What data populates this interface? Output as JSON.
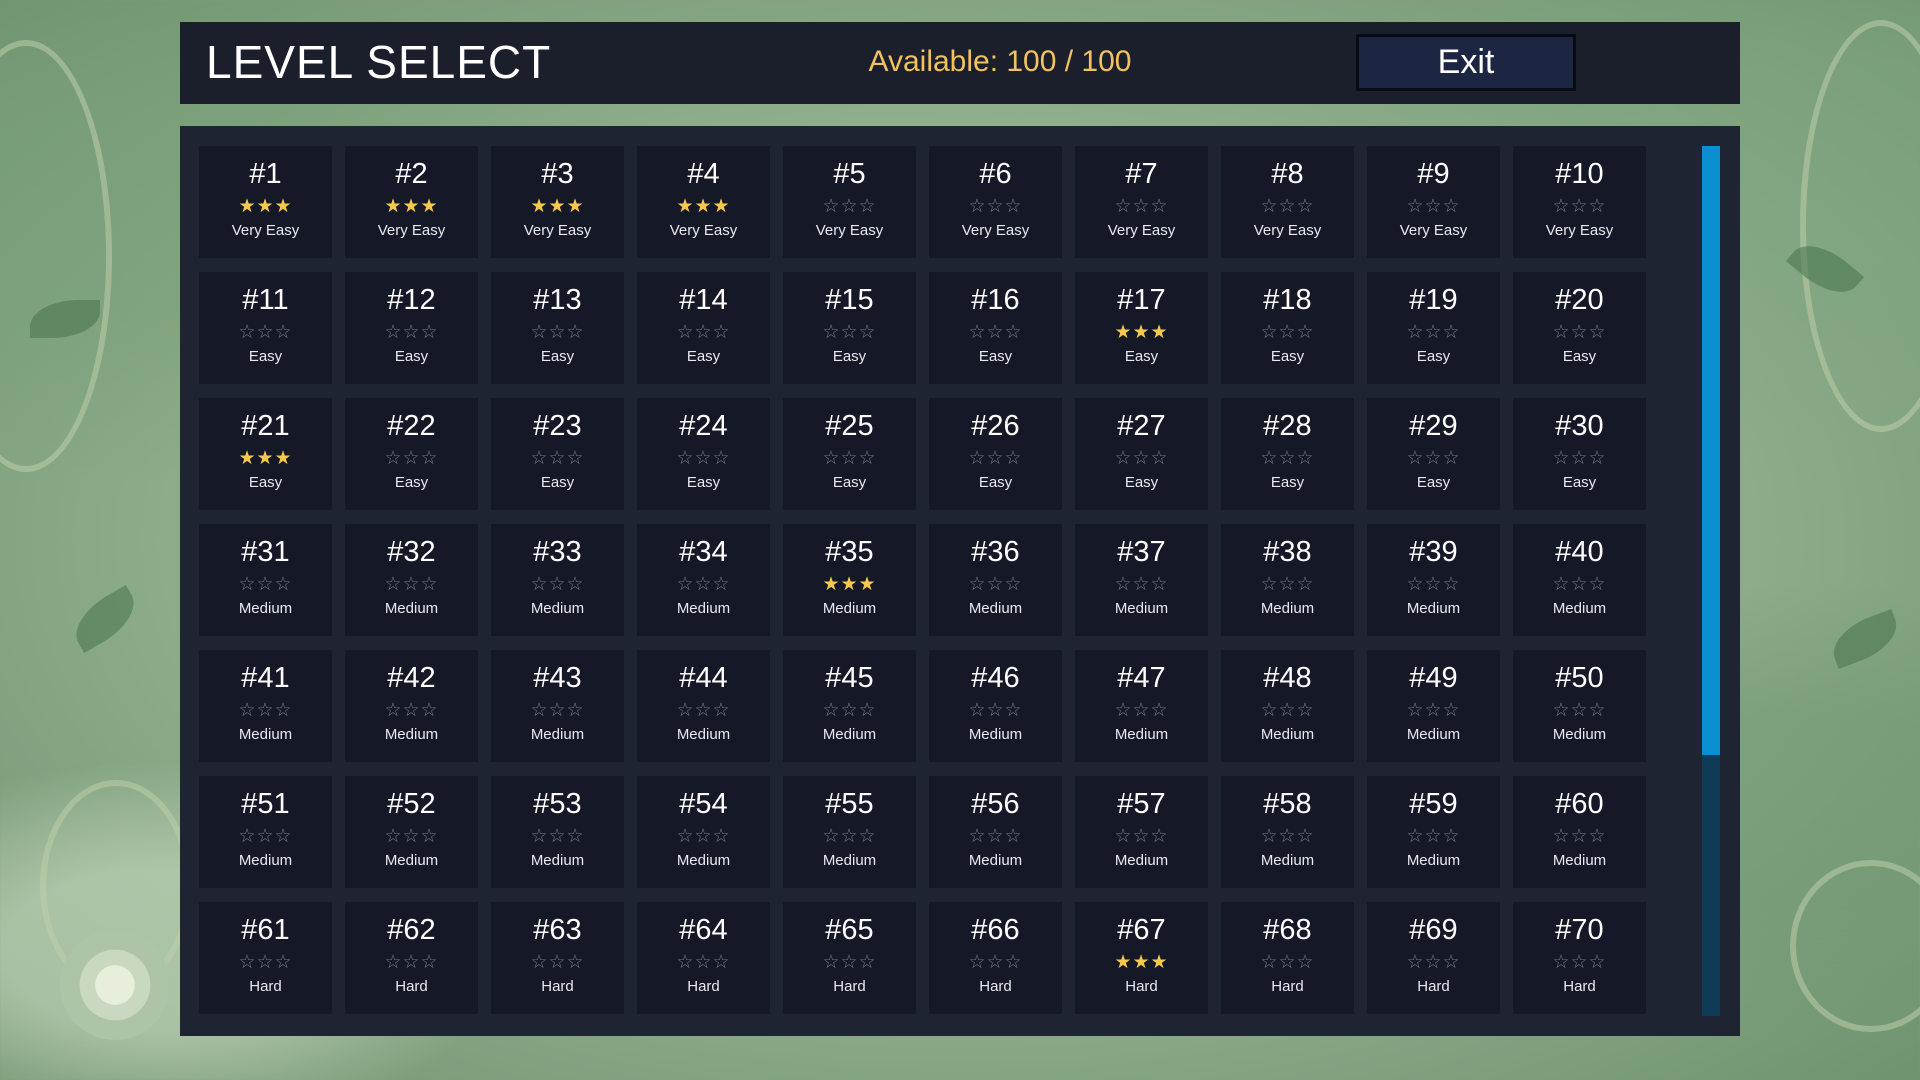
{
  "header": {
    "title": "LEVEL SELECT",
    "available": "Available: 100 / 100",
    "exit_label": "Exit"
  },
  "colors": {
    "available_text": "#f2c260",
    "star_earned": "#f5c94c",
    "star_empty": "#747a8c",
    "scrollbar_thumb": "#0a8fd0",
    "scrollbar_track": "#0e3b55"
  },
  "scroll": {
    "thumb_fraction": 0.7,
    "position_fraction": 0.0
  },
  "levels": [
    {
      "label": "#1",
      "stars": "★★★",
      "earned": true,
      "difficulty": "Very Easy"
    },
    {
      "label": "#2",
      "stars": "★★★",
      "earned": true,
      "difficulty": "Very Easy"
    },
    {
      "label": "#3",
      "stars": "★★★",
      "earned": true,
      "difficulty": "Very Easy"
    },
    {
      "label": "#4",
      "stars": "★★★",
      "earned": true,
      "difficulty": "Very Easy"
    },
    {
      "label": "#5",
      "stars": "☆☆☆",
      "earned": false,
      "difficulty": "Very Easy"
    },
    {
      "label": "#6",
      "stars": "☆☆☆",
      "earned": false,
      "difficulty": "Very Easy"
    },
    {
      "label": "#7",
      "stars": "☆☆☆",
      "earned": false,
      "difficulty": "Very Easy"
    },
    {
      "label": "#8",
      "stars": "☆☆☆",
      "earned": false,
      "difficulty": "Very Easy"
    },
    {
      "label": "#9",
      "stars": "☆☆☆",
      "earned": false,
      "difficulty": "Very Easy"
    },
    {
      "label": "#10",
      "stars": "☆☆☆",
      "earned": false,
      "difficulty": "Very Easy"
    },
    {
      "label": "#11",
      "stars": "☆☆☆",
      "earned": false,
      "difficulty": "Easy"
    },
    {
      "label": "#12",
      "stars": "☆☆☆",
      "earned": false,
      "difficulty": "Easy"
    },
    {
      "label": "#13",
      "stars": "☆☆☆",
      "earned": false,
      "difficulty": "Easy"
    },
    {
      "label": "#14",
      "stars": "☆☆☆",
      "earned": false,
      "difficulty": "Easy"
    },
    {
      "label": "#15",
      "stars": "☆☆☆",
      "earned": false,
      "difficulty": "Easy"
    },
    {
      "label": "#16",
      "stars": "☆☆☆",
      "earned": false,
      "difficulty": "Easy"
    },
    {
      "label": "#17",
      "stars": "★★★",
      "earned": true,
      "difficulty": "Easy"
    },
    {
      "label": "#18",
      "stars": "☆☆☆",
      "earned": false,
      "difficulty": "Easy"
    },
    {
      "label": "#19",
      "stars": "☆☆☆",
      "earned": false,
      "difficulty": "Easy"
    },
    {
      "label": "#20",
      "stars": "☆☆☆",
      "earned": false,
      "difficulty": "Easy"
    },
    {
      "label": "#21",
      "stars": "★★★",
      "earned": true,
      "difficulty": "Easy"
    },
    {
      "label": "#22",
      "stars": "☆☆☆",
      "earned": false,
      "difficulty": "Easy"
    },
    {
      "label": "#23",
      "stars": "☆☆☆",
      "earned": false,
      "difficulty": "Easy"
    },
    {
      "label": "#24",
      "stars": "☆☆☆",
      "earned": false,
      "difficulty": "Easy"
    },
    {
      "label": "#25",
      "stars": "☆☆☆",
      "earned": false,
      "difficulty": "Easy"
    },
    {
      "label": "#26",
      "stars": "☆☆☆",
      "earned": false,
      "difficulty": "Easy"
    },
    {
      "label": "#27",
      "stars": "☆☆☆",
      "earned": false,
      "difficulty": "Easy"
    },
    {
      "label": "#28",
      "stars": "☆☆☆",
      "earned": false,
      "difficulty": "Easy"
    },
    {
      "label": "#29",
      "stars": "☆☆☆",
      "earned": false,
      "difficulty": "Easy"
    },
    {
      "label": "#30",
      "stars": "☆☆☆",
      "earned": false,
      "difficulty": "Easy"
    },
    {
      "label": "#31",
      "stars": "☆☆☆",
      "earned": false,
      "difficulty": "Medium"
    },
    {
      "label": "#32",
      "stars": "☆☆☆",
      "earned": false,
      "difficulty": "Medium"
    },
    {
      "label": "#33",
      "stars": "☆☆☆",
      "earned": false,
      "difficulty": "Medium"
    },
    {
      "label": "#34",
      "stars": "☆☆☆",
      "earned": false,
      "difficulty": "Medium"
    },
    {
      "label": "#35",
      "stars": "★★★",
      "earned": true,
      "difficulty": "Medium"
    },
    {
      "label": "#36",
      "stars": "☆☆☆",
      "earned": false,
      "difficulty": "Medium"
    },
    {
      "label": "#37",
      "stars": "☆☆☆",
      "earned": false,
      "difficulty": "Medium"
    },
    {
      "label": "#38",
      "stars": "☆☆☆",
      "earned": false,
      "difficulty": "Medium"
    },
    {
      "label": "#39",
      "stars": "☆☆☆",
      "earned": false,
      "difficulty": "Medium"
    },
    {
      "label": "#40",
      "stars": "☆☆☆",
      "earned": false,
      "difficulty": "Medium"
    },
    {
      "label": "#41",
      "stars": "☆☆☆",
      "earned": false,
      "difficulty": "Medium"
    },
    {
      "label": "#42",
      "stars": "☆☆☆",
      "earned": false,
      "difficulty": "Medium"
    },
    {
      "label": "#43",
      "stars": "☆☆☆",
      "earned": false,
      "difficulty": "Medium"
    },
    {
      "label": "#44",
      "stars": "☆☆☆",
      "earned": false,
      "difficulty": "Medium"
    },
    {
      "label": "#45",
      "stars": "☆☆☆",
      "earned": false,
      "difficulty": "Medium"
    },
    {
      "label": "#46",
      "stars": "☆☆☆",
      "earned": false,
      "difficulty": "Medium"
    },
    {
      "label": "#47",
      "stars": "☆☆☆",
      "earned": false,
      "difficulty": "Medium"
    },
    {
      "label": "#48",
      "stars": "☆☆☆",
      "earned": false,
      "difficulty": "Medium"
    },
    {
      "label": "#49",
      "stars": "☆☆☆",
      "earned": false,
      "difficulty": "Medium"
    },
    {
      "label": "#50",
      "stars": "☆☆☆",
      "earned": false,
      "difficulty": "Medium"
    },
    {
      "label": "#51",
      "stars": "☆☆☆",
      "earned": false,
      "difficulty": "Medium"
    },
    {
      "label": "#52",
      "stars": "☆☆☆",
      "earned": false,
      "difficulty": "Medium"
    },
    {
      "label": "#53",
      "stars": "☆☆☆",
      "earned": false,
      "difficulty": "Medium"
    },
    {
      "label": "#54",
      "stars": "☆☆☆",
      "earned": false,
      "difficulty": "Medium"
    },
    {
      "label": "#55",
      "stars": "☆☆☆",
      "earned": false,
      "difficulty": "Medium"
    },
    {
      "label": "#56",
      "stars": "☆☆☆",
      "earned": false,
      "difficulty": "Medium"
    },
    {
      "label": "#57",
      "stars": "☆☆☆",
      "earned": false,
      "difficulty": "Medium"
    },
    {
      "label": "#58",
      "stars": "☆☆☆",
      "earned": false,
      "difficulty": "Medium"
    },
    {
      "label": "#59",
      "stars": "☆☆☆",
      "earned": false,
      "difficulty": "Medium"
    },
    {
      "label": "#60",
      "stars": "☆☆☆",
      "earned": false,
      "difficulty": "Medium"
    },
    {
      "label": "#61",
      "stars": "☆☆☆",
      "earned": false,
      "difficulty": "Hard"
    },
    {
      "label": "#62",
      "stars": "☆☆☆",
      "earned": false,
      "difficulty": "Hard"
    },
    {
      "label": "#63",
      "stars": "☆☆☆",
      "earned": false,
      "difficulty": "Hard"
    },
    {
      "label": "#64",
      "stars": "☆☆☆",
      "earned": false,
      "difficulty": "Hard"
    },
    {
      "label": "#65",
      "stars": "☆☆☆",
      "earned": false,
      "difficulty": "Hard"
    },
    {
      "label": "#66",
      "stars": "☆☆☆",
      "earned": false,
      "difficulty": "Hard"
    },
    {
      "label": "#67",
      "stars": "★★★",
      "earned": true,
      "difficulty": "Hard"
    },
    {
      "label": "#68",
      "stars": "☆☆☆",
      "earned": false,
      "difficulty": "Hard"
    },
    {
      "label": "#69",
      "stars": "☆☆☆",
      "earned": false,
      "difficulty": "Hard"
    },
    {
      "label": "#70",
      "stars": "☆☆☆",
      "earned": false,
      "difficulty": "Hard"
    }
  ]
}
